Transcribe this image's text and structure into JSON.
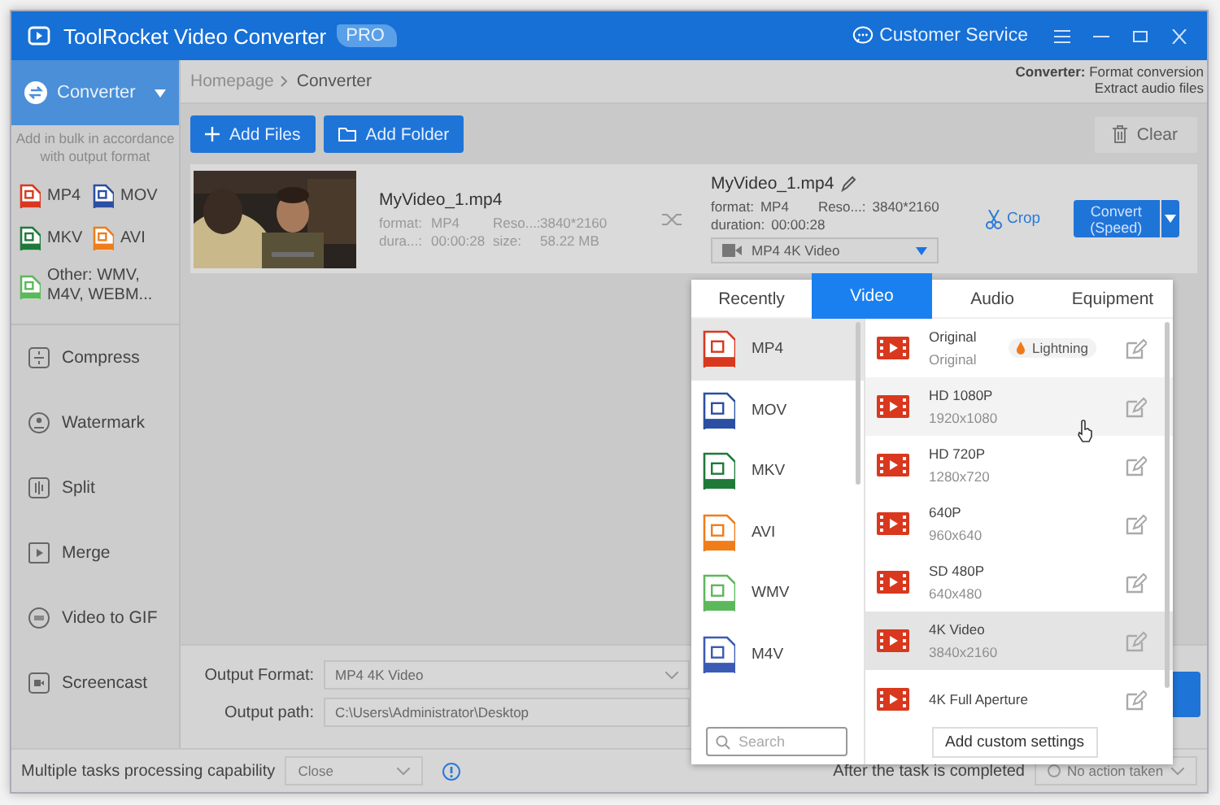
{
  "window": {
    "title": "ToolRocket Video Converter",
    "badge": "PRO",
    "service": "Customer Service"
  },
  "sidebar": {
    "converter": {
      "label": "Converter",
      "selected": true
    },
    "hint": "Add in bulk in accordance with output format",
    "formats": [
      {
        "label": "MP4",
        "color": "#d9381e"
      },
      {
        "label": "MOV",
        "color": "#2b4fa3"
      },
      {
        "label": "MKV",
        "color": "#1f7a3a"
      },
      {
        "label": "AVI",
        "color": "#ef7d1a"
      },
      {
        "label": "Other: WMV, M4V, WEBM...",
        "color": "#5cb85c"
      }
    ],
    "tools": [
      {
        "label": "Compress",
        "kind": "compress"
      },
      {
        "label": "Watermark",
        "kind": "watermark"
      },
      {
        "label": "Split",
        "kind": "split"
      },
      {
        "label": "Merge",
        "kind": "merge"
      },
      {
        "label": "Video to GIF",
        "kind": "gif"
      },
      {
        "label": "Screencast",
        "kind": "screencast"
      }
    ]
  },
  "breadcrumb": [
    "Homepage",
    "Converter"
  ],
  "header_note": [
    "**Converter:** Format conversion",
    "Extract audio files"
  ],
  "toolbar": {
    "add_files": "Add Files",
    "add_folder": "Add Folder",
    "clear": "Clear"
  },
  "file": {
    "source": {
      "name": "MyVideo_1.mp4",
      "fields": [
        [
          "format:",
          "MP4"
        ],
        [
          "Reso...:",
          "3840*2160"
        ],
        [
          "dura...:",
          "00:00:28"
        ],
        [
          "size:",
          "58.22 MB"
        ]
      ]
    },
    "target": {
      "name": "MyVideo_1.mp4",
      "format_label": "format:",
      "format": "MP4",
      "reso_label": "Reso...:",
      "reso": "3840*2160",
      "duration_label": "duration:",
      "duration": "00:00:28",
      "preset": "MP4  4K Video"
    },
    "crop": "Crop",
    "convert": [
      "Convert",
      "(Speed)"
    ]
  },
  "output": {
    "format_label": "Output Format:",
    "format_value": "MP4  4K Video",
    "path_label": "Output path:",
    "path_value": "C:\\Users\\Administrator\\Desktop"
  },
  "bottom": {
    "tasks_label": "Multiple tasks processing capability",
    "tasks_value": "Close",
    "after_label": "After the task is completed",
    "after_value": "No action taken"
  },
  "popup": {
    "tabs": [
      {
        "label": "Recently",
        "selected": false
      },
      {
        "label": "Video",
        "selected": true
      },
      {
        "label": "Audio",
        "selected": false
      },
      {
        "label": "Equipment",
        "selected": false
      }
    ],
    "formats": [
      {
        "label": "MP4",
        "color": "#d9381e",
        "selected": true
      },
      {
        "label": "MOV",
        "color": "#2b4fa3",
        "selected": false
      },
      {
        "label": "MKV",
        "color": "#1f7a3a",
        "selected": false
      },
      {
        "label": "AVI",
        "color": "#ef7d1a",
        "selected": false
      },
      {
        "label": "WMV",
        "color": "#5cb85c",
        "selected": false
      },
      {
        "label": "M4V",
        "color": "#3b5bb5",
        "selected": false
      }
    ],
    "presets": [
      {
        "title": "Original",
        "subtitle": "Original",
        "badge": "Lightning",
        "selected": false
      },
      {
        "title": "HD 1080P",
        "subtitle": "1920x1080",
        "selected": false,
        "hovered": true
      },
      {
        "title": "HD 720P",
        "subtitle": "1280x720",
        "selected": false
      },
      {
        "title": "640P",
        "subtitle": "960x640",
        "selected": false
      },
      {
        "title": "SD 480P",
        "subtitle": "640x480",
        "selected": false
      },
      {
        "title": "4K Video",
        "subtitle": "3840x2160",
        "selected": true
      },
      {
        "title": "4K Full Aperture",
        "selected": false
      }
    ],
    "search_placeholder": "Search",
    "add_custom": "Add custom settings"
  }
}
